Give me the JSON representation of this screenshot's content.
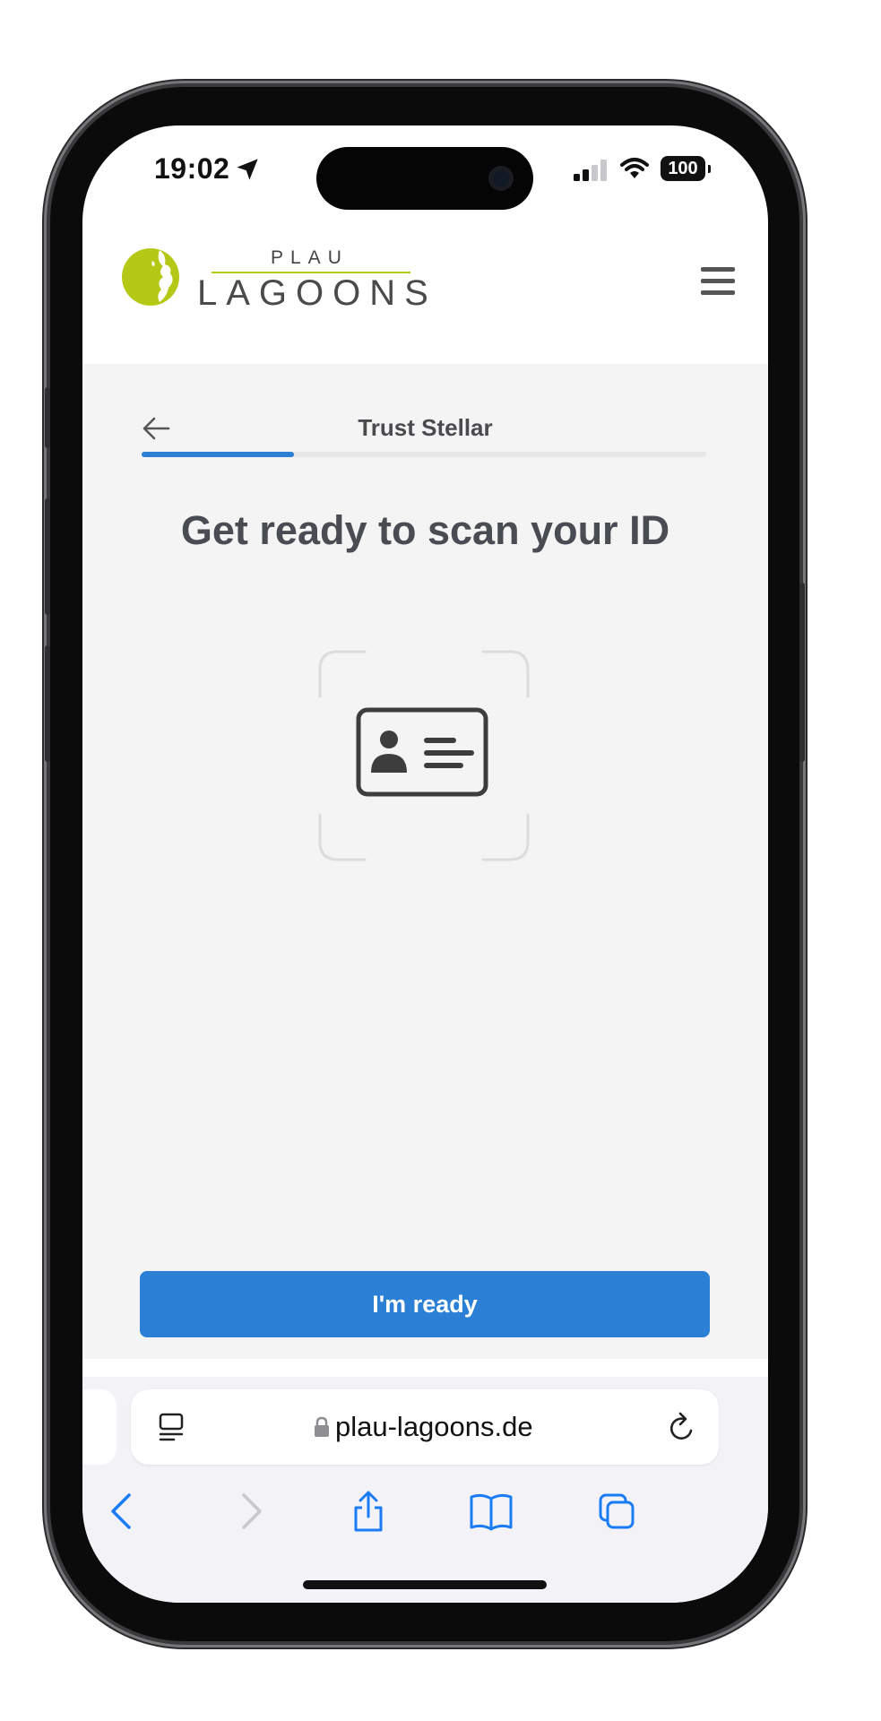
{
  "status_bar": {
    "time": "19:02",
    "battery": "100",
    "location_icon": "location-arrow-icon",
    "signal_icon": "cellular-signal-icon",
    "wifi_icon": "wifi-icon"
  },
  "site_header": {
    "logo_top": "PLAU",
    "logo_bottom": "LAGOONS",
    "logo_icon": "globe-logo-icon",
    "menu_icon": "hamburger-menu-icon",
    "logo_green": "#b5c816"
  },
  "verification": {
    "title": "Trust Stellar",
    "back_icon": "back-arrow-icon",
    "progress_fraction": 0.27,
    "heading": "Get ready to scan your ID",
    "illustration_icon": "id-card-icon",
    "primary_button": "I'm ready",
    "accent": "#2b7fd4"
  },
  "browser": {
    "url": "plau-lagoons.de",
    "reader_icon": "reader-mode-icon",
    "lock_icon": "lock-icon",
    "reload_icon": "reload-icon",
    "toolbar": [
      {
        "name": "back",
        "icon": "chevron-left-icon",
        "enabled": true
      },
      {
        "name": "forward",
        "icon": "chevron-right-icon",
        "enabled": false
      },
      {
        "name": "share",
        "icon": "share-icon",
        "enabled": true
      },
      {
        "name": "bookmarks",
        "icon": "book-icon",
        "enabled": true
      },
      {
        "name": "tabs",
        "icon": "tabs-icon",
        "enabled": true
      }
    ],
    "tint": "#1a7cf5"
  }
}
